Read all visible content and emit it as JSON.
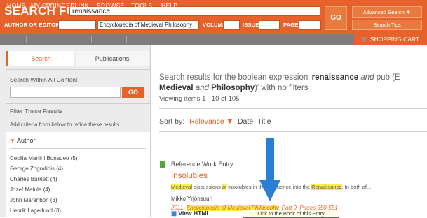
{
  "search": {
    "title": "SEARCH FOR",
    "query": "renaissance",
    "go": "GO",
    "advanced": "Advanced Search ▼",
    "tips": "Search Tips",
    "fields": {
      "author_label": "AUTHOR OR EDITOR",
      "publication_value": "Encyclopedia of Medieval Philosophy",
      "volume_label": "VOLUME",
      "issue_label": "ISSUE",
      "page_label": "PAGE"
    }
  },
  "nav": {
    "items": [
      "HOME",
      "MY SPRINGERLINK",
      "BROWSE",
      "TOOLS",
      "HELP"
    ],
    "cart": "SHOPPING CART"
  },
  "sidebar": {
    "tabs": [
      "Search",
      "Publications"
    ],
    "search_within_label": "Search Within All Content",
    "go": "GO",
    "filter_label": "Filter These Results",
    "add_criteria": "Add criteria from below to refine these results",
    "author_header": "Author",
    "authors": [
      "Cecilia Martini Bonadeo (5)",
      "George Zografidis (4)",
      "Charles Burnett (4)",
      "Jozef Matula (4)",
      "John Marenbon (3)",
      "Henrik Lagerlund (3)"
    ]
  },
  "results": {
    "desc_prefix": "Search results for the boolean expression '",
    "desc_term1": "renaissance",
    "desc_and": " and ",
    "desc_pub": "pub:(E",
    "desc_line2_a": "Medieval",
    "desc_line2_b": " and ",
    "desc_line2_c": "Philosophy",
    "desc_line2_d": ")' with no filters",
    "viewing": "Viewing items 1 - 10 of 105",
    "sort_label": "Sort by:",
    "sort_relevance": "Relevance ▼",
    "sort_date": "Date",
    "sort_title": "Title",
    "item": {
      "type": "Reference Work Entry",
      "title": "Insolubles",
      "snip_1": "Medieval",
      "snip_2": " discussions ",
      "snip_3": "of",
      "snip_4": " insolubles in the...influence into the ",
      "snip_5": "Renaissance",
      "snip_6": ". In both of...",
      "author": "Mikko Yrjönsuuri",
      "cite_year": "2011, ",
      "cite_pub": "Encyclopedia of Medieval Philosophy",
      "cite_rest": ", Part 9, Pages 550-551",
      "view_html": "View HTML",
      "tooltip": "Link to the Book of this Entry"
    }
  },
  "colors": {
    "brand_orange": "#e7622a",
    "nav_gray": "#7d7d7d",
    "highlight": "#f7f14a",
    "arrow_blue": "#2a7fd4",
    "entry_green": "#54a731"
  }
}
